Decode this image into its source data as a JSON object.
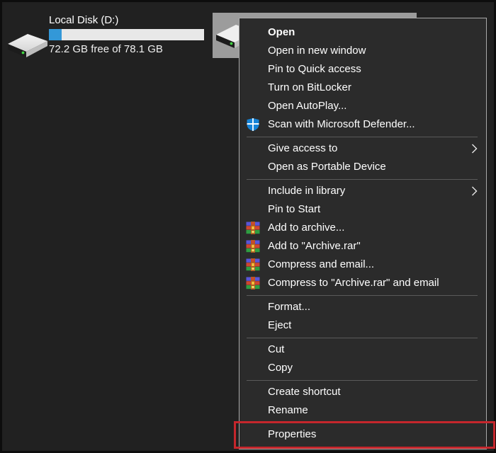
{
  "drive": {
    "label": "Local Disk (D:)",
    "free_text": "72.2 GB free of 78.1 GB",
    "used_percent": 8,
    "bar_fill_color": "#3398d8",
    "bar_bg_color": "#e8e8e8"
  },
  "menu": {
    "groups": [
      {
        "items": [
          {
            "label": "Open",
            "bold": true
          },
          {
            "label": "Open in new window"
          },
          {
            "label": "Pin to Quick access"
          },
          {
            "label": "Turn on BitLocker"
          },
          {
            "label": "Open AutoPlay..."
          },
          {
            "label": "Scan with Microsoft Defender...",
            "icon": "defender-icon"
          }
        ]
      },
      {
        "items": [
          {
            "label": "Give access to",
            "submenu": true
          },
          {
            "label": "Open as Portable Device"
          }
        ]
      },
      {
        "items": [
          {
            "label": "Include in library",
            "submenu": true
          },
          {
            "label": "Pin to Start"
          },
          {
            "label": "Add to archive...",
            "icon": "winrar-icon"
          },
          {
            "label": "Add to \"Archive.rar\"",
            "icon": "winrar-icon"
          },
          {
            "label": "Compress and email...",
            "icon": "winrar-icon"
          },
          {
            "label": "Compress to \"Archive.rar\" and email",
            "icon": "winrar-icon"
          }
        ]
      },
      {
        "items": [
          {
            "label": "Format..."
          },
          {
            "label": "Eject"
          }
        ]
      },
      {
        "items": [
          {
            "label": "Cut"
          },
          {
            "label": "Copy"
          }
        ]
      },
      {
        "items": [
          {
            "label": "Create shortcut"
          },
          {
            "label": "Rename"
          }
        ]
      },
      {
        "items": [
          {
            "label": "Properties",
            "annotated": true
          }
        ]
      }
    ]
  },
  "annotation": {
    "target": "Properties",
    "color": "#c5262c"
  },
  "colors": {
    "background": "#212121",
    "menu_background": "#2b2b2b",
    "menu_border": "#a9a9a9",
    "selected_tile": "#9c9c9c",
    "defender_blue": "#1583d7"
  }
}
